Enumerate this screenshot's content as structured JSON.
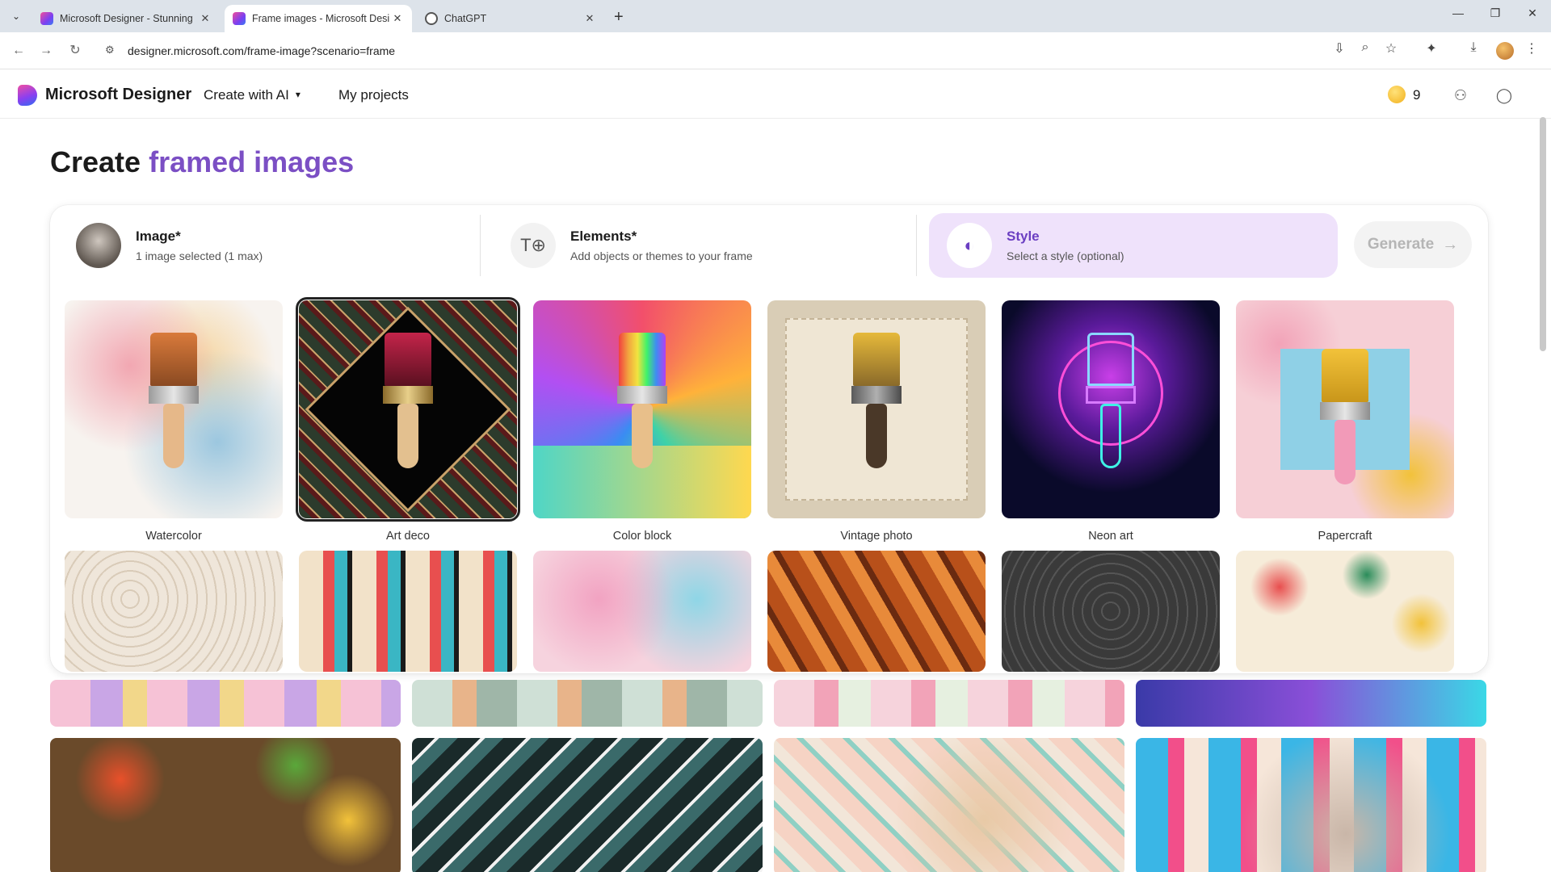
{
  "browser": {
    "tabs": [
      {
        "title": "Microsoft Designer - Stunning",
        "active": false,
        "favicon": "designer-icon"
      },
      {
        "title": "Frame images - Microsoft Desi",
        "active": true,
        "favicon": "designer-icon"
      },
      {
        "title": "ChatGPT",
        "active": false,
        "favicon": "chatgpt-icon"
      }
    ],
    "url": "designer.microsoft.com/frame-image?scenario=frame"
  },
  "app": {
    "brand": "Microsoft Designer",
    "nav": {
      "create": "Create with AI",
      "projects": "My projects"
    },
    "credits": "9"
  },
  "page": {
    "title_plain": "Create",
    "title_accent": "framed images"
  },
  "steps": {
    "image": {
      "title": "Image*",
      "subtitle": "1 image selected (1 max)"
    },
    "elements": {
      "title": "Elements*",
      "subtitle": "Add objects or themes to your frame"
    },
    "style": {
      "title": "Style",
      "subtitle": "Select a style (optional)"
    },
    "generate_label": "Generate"
  },
  "styles": [
    {
      "label": "Watercolor",
      "selected": false
    },
    {
      "label": "Art deco",
      "selected": true
    },
    {
      "label": "Color block",
      "selected": false
    },
    {
      "label": "Vintage photo",
      "selected": false
    },
    {
      "label": "Neon art",
      "selected": false
    },
    {
      "label": "Papercraft",
      "selected": false
    }
  ],
  "colors": {
    "accent": "#7b4fc4",
    "style_active_bg": "#efe2fb"
  }
}
